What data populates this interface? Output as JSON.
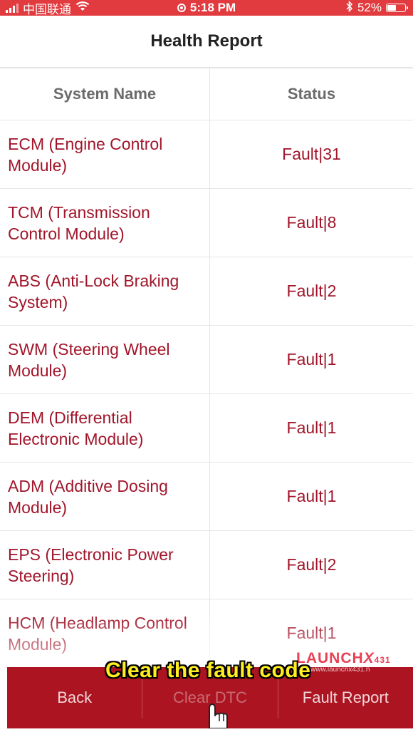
{
  "status_bar": {
    "carrier": "中国联通",
    "time": "5:18 PM",
    "battery": "52%",
    "battery_level": 0.52,
    "icons": [
      "signal-icon",
      "wifi-icon",
      "location-icon",
      "bluetooth-icon",
      "battery-icon"
    ]
  },
  "header": {
    "title": "Health Report"
  },
  "table": {
    "headers": [
      "System Name",
      "Status"
    ],
    "rows": [
      {
        "name": "ECM (Engine Control Module)",
        "status": "Fault|31"
      },
      {
        "name": "TCM (Transmission Control Module)",
        "status": "Fault|8"
      },
      {
        "name": "ABS (Anti-Lock Braking System)",
        "status": "Fault|2"
      },
      {
        "name": "SWM (Steering Wheel Module)",
        "status": "Fault|1"
      },
      {
        "name": "DEM (Differential Electronic Module)",
        "status": "Fault|1"
      },
      {
        "name": "ADM (Additive Dosing Module)",
        "status": "Fault|1"
      },
      {
        "name": "EPS (Electronic Power Steering)",
        "status": "Fault|2"
      },
      {
        "name": "HCM (Headlamp Control Module)",
        "status": "Fault|1"
      }
    ]
  },
  "bottom_bar": {
    "back": "Back",
    "clear_dtc": "Clear DTC",
    "fault_report": "Fault Report"
  },
  "overlay": {
    "caption": "Clear the fault code",
    "watermark_brand": "LAUNCH",
    "watermark_x": "X",
    "watermark_num": "431",
    "watermark_url": "www.launchx431.n"
  },
  "colors": {
    "status_bar": "#e23b3f",
    "accent_text": "#a1152a",
    "bottom_bar": "#ac1421",
    "caption": "#ffee22"
  }
}
